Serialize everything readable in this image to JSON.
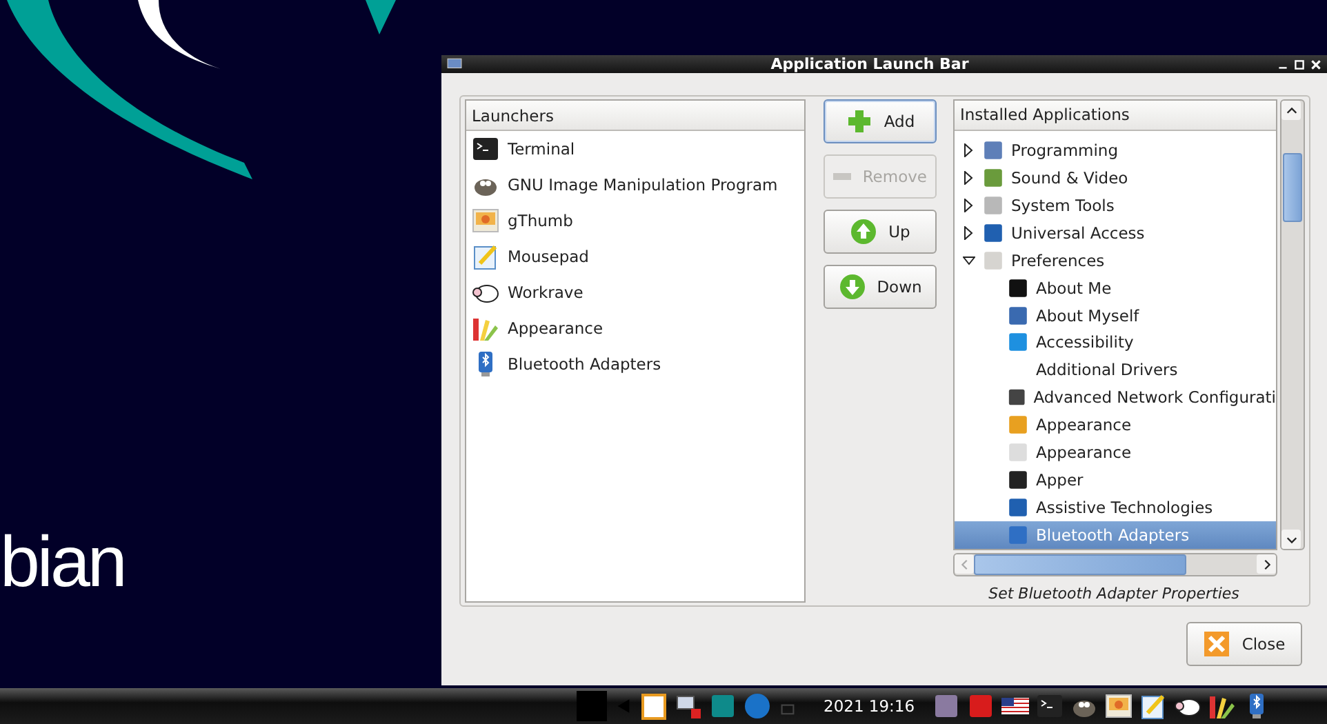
{
  "desktop": {
    "logo_text": "bian"
  },
  "window": {
    "title": "Application Launch Bar"
  },
  "launchers": {
    "header": "Launchers",
    "items": [
      {
        "label": "Terminal"
      },
      {
        "label": "GNU Image Manipulation Program"
      },
      {
        "label": "gThumb"
      },
      {
        "label": "Mousepad"
      },
      {
        "label": "Workrave"
      },
      {
        "label": "Appearance"
      },
      {
        "label": "Bluetooth Adapters"
      }
    ]
  },
  "buttons": [
    {
      "label": "Add",
      "disabled": false,
      "focused": true,
      "kind": "add"
    },
    {
      "label": "Remove",
      "disabled": true,
      "focused": false,
      "kind": "remove"
    },
    {
      "label": "Up",
      "disabled": false,
      "focused": false,
      "kind": "up"
    },
    {
      "label": "Down",
      "disabled": false,
      "focused": false,
      "kind": "down"
    }
  ],
  "installed": {
    "header": "Installed Applications",
    "items": [
      {
        "label": "Programming",
        "expanded": false,
        "selected": false
      },
      {
        "label": "Sound & Video",
        "expanded": false,
        "selected": false
      },
      {
        "label": "System Tools",
        "expanded": false,
        "selected": false
      },
      {
        "label": "Universal Access",
        "expanded": false,
        "selected": false
      },
      {
        "label": "Preferences",
        "expanded": true,
        "selected": false,
        "children": [
          {
            "label": "About Me",
            "selected": false
          },
          {
            "label": "About Myself",
            "selected": false
          },
          {
            "label": "Accessibility",
            "selected": false
          },
          {
            "label": "Additional Drivers",
            "selected": false
          },
          {
            "label": "Advanced Network Configurati",
            "selected": false
          },
          {
            "label": "Appearance",
            "selected": false
          },
          {
            "label": "Appearance",
            "selected": false
          },
          {
            "label": "Apper",
            "selected": false
          },
          {
            "label": "Assistive Technologies",
            "selected": false
          },
          {
            "label": "Bluetooth Adapters",
            "selected": true
          }
        ]
      }
    ]
  },
  "description": "Set Bluetooth Adapter Properties",
  "close_button": {
    "label": "Close"
  },
  "taskbar": {
    "clock": "2021 19:16"
  }
}
